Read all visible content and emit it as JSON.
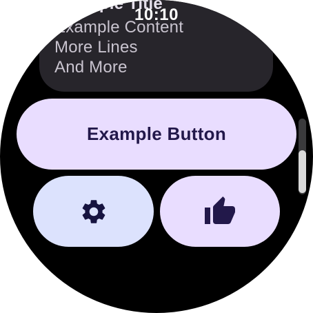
{
  "status": {
    "time": "10:10"
  },
  "card": {
    "title": "Example Title",
    "lines": [
      "Example Content",
      "More Lines",
      "And More"
    ]
  },
  "buttons": {
    "main_label": "Example Button",
    "settings_icon": "gear-icon",
    "like_icon": "thumb-up-icon"
  },
  "colors": {
    "background": "#000000",
    "card": "#27252b",
    "primary_button": "#e9ddff",
    "secondary_button": "#dce2fd",
    "button_text": "#22184a"
  }
}
